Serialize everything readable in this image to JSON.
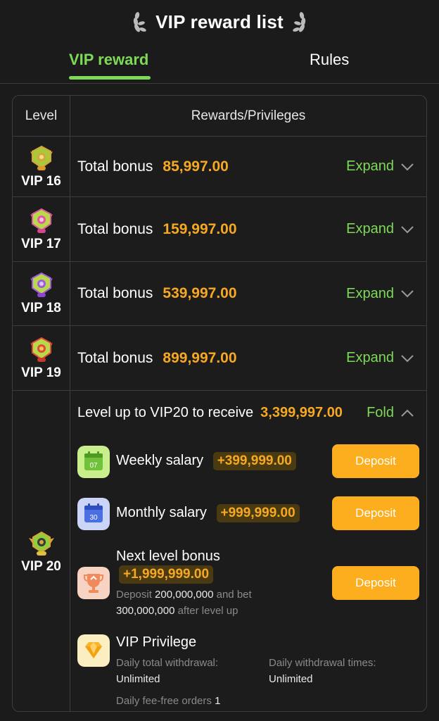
{
  "header": {
    "title": "VIP reward list"
  },
  "tabs": [
    {
      "label": "VIP reward",
      "active": true
    },
    {
      "label": "Rules",
      "active": false
    }
  ],
  "table": {
    "col_level": "Level",
    "col_rewards": "Rewards/Privileges",
    "rows": [
      {
        "vip": "VIP 16",
        "bonus_label": "Total bonus",
        "bonus": "85,997.00",
        "action": "Expand"
      },
      {
        "vip": "VIP 17",
        "bonus_label": "Total bonus",
        "bonus": "159,997.00",
        "action": "Expand"
      },
      {
        "vip": "VIP 18",
        "bonus_label": "Total bonus",
        "bonus": "539,997.00",
        "action": "Expand"
      },
      {
        "vip": "VIP 19",
        "bonus_label": "Total bonus",
        "bonus": "899,997.00",
        "action": "Expand"
      }
    ],
    "vip20": {
      "vip": "VIP 20",
      "header_text": "Level up to VIP20 to receive",
      "total": "3,399,997.00",
      "action": "Fold",
      "weekly": {
        "label": "Weekly salary",
        "amount": "+399,999.00",
        "icon_text": "07",
        "button": "Deposit"
      },
      "monthly": {
        "label": "Monthly salary",
        "amount": "+999,999.00",
        "icon_text": "30",
        "button": "Deposit"
      },
      "next_level": {
        "label": "Next level bonus",
        "amount": "+1,999,999.00",
        "deposit_text": "Deposit",
        "deposit_value": "200,000,000",
        "and_bet_text": "and bet",
        "bet_value": "300,000,000",
        "after_text": "after level up",
        "button": "Deposit"
      },
      "privilege": {
        "label": "VIP Privilege",
        "withdrawal_label": "Daily total withdrawal:",
        "withdrawal_value": "Unlimited",
        "times_label": "Daily withdrawal times:",
        "times_value": "Unlimited",
        "fee_free_label": "Daily fee-free orders",
        "fee_free_value": "1"
      }
    }
  },
  "colors": {
    "accent_green": "#7ed957",
    "amount_orange": "#f7a823",
    "button_orange": "#fcae1e",
    "background": "#1b1b1b"
  }
}
